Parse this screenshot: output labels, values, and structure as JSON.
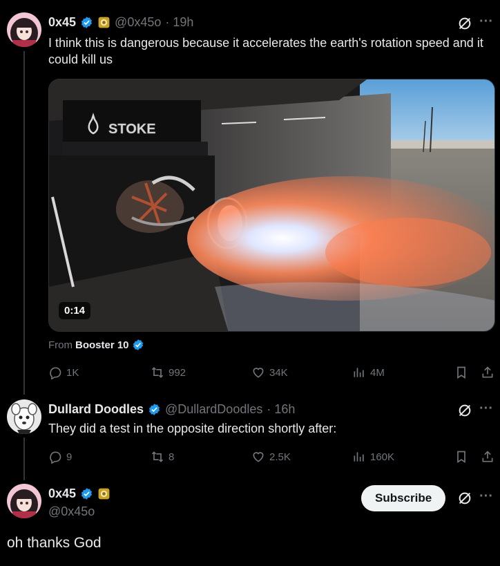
{
  "tweet1": {
    "name": "0x45",
    "handle": "@0x45o",
    "time": "· 19h",
    "text": "I think this is dangerous because it accelerates the earth's rotation speed and it could kill us",
    "video_duration": "0:14",
    "video_logo": "STOKE",
    "from_label": "From",
    "from_source": "Booster 10",
    "stats": {
      "replies": "1K",
      "reposts": "992",
      "likes": "34K",
      "views": "4M"
    }
  },
  "tweet2": {
    "name": "Dullard Doodles",
    "handle": "@DullardDoodles",
    "time": "· 16h",
    "text": "They did a test in the opposite direction shortly after:",
    "stats": {
      "replies": "9",
      "reposts": "8",
      "likes": "2.5K",
      "views": "160K"
    }
  },
  "tweet3": {
    "name": "0x45",
    "handle": "@0x45o",
    "subscribe_label": "Subscribe",
    "text": "oh thanks God"
  },
  "icons": {
    "more": "···",
    "verified_color": "#1d9bf0",
    "gold_badge_color": "#e8b923"
  }
}
